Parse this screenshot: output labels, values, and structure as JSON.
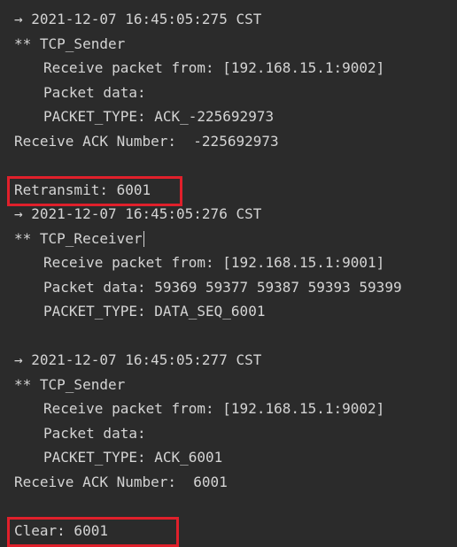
{
  "console": {
    "lines": [
      {
        "text": "→ 2021-12-07 16:45:05:275 CST",
        "indent": 0
      },
      {
        "text": "** TCP_Sender",
        "indent": 0
      },
      {
        "text": "Receive packet from: [192.168.15.1:9002]",
        "indent": 1
      },
      {
        "text": "Packet data:",
        "indent": 1
      },
      {
        "text": "PACKET_TYPE: ACK_-225692973",
        "indent": 1
      },
      {
        "text": "Receive ACK Number:  -225692973",
        "indent": 0
      },
      {
        "text": "",
        "indent": 0
      },
      {
        "text": "Retransmit: 6001",
        "indent": 0
      },
      {
        "text": "→ 2021-12-07 16:45:05:276 CST",
        "indent": 0
      },
      {
        "text": "** TCP_Receiver",
        "indent": 0
      },
      {
        "text": "Receive packet from: [192.168.15.1:9001]",
        "indent": 1
      },
      {
        "text": "Packet data: 59369 59377 59387 59393 59399",
        "indent": 1
      },
      {
        "text": "PACKET_TYPE: DATA_SEQ_6001",
        "indent": 1
      },
      {
        "text": "",
        "indent": 0
      },
      {
        "text": "→ 2021-12-07 16:45:05:277 CST",
        "indent": 0
      },
      {
        "text": "** TCP_Sender",
        "indent": 0
      },
      {
        "text": "Receive packet from: [192.168.15.1:9002]",
        "indent": 1
      },
      {
        "text": "Packet data:",
        "indent": 1
      },
      {
        "text": "PACKET_TYPE: ACK_6001",
        "indent": 1
      },
      {
        "text": "Receive ACK Number:  6001",
        "indent": 0
      },
      {
        "text": "",
        "indent": 0
      },
      {
        "text": "Clear: 6001",
        "indent": 0
      }
    ]
  },
  "highlights": {
    "color": "#e0202b",
    "retransmit_line_index": 7,
    "clear_line_index": 21
  },
  "cursor_line_index": 9,
  "colors": {
    "background": "#2b2b2b",
    "text": "#d4d4d4"
  }
}
